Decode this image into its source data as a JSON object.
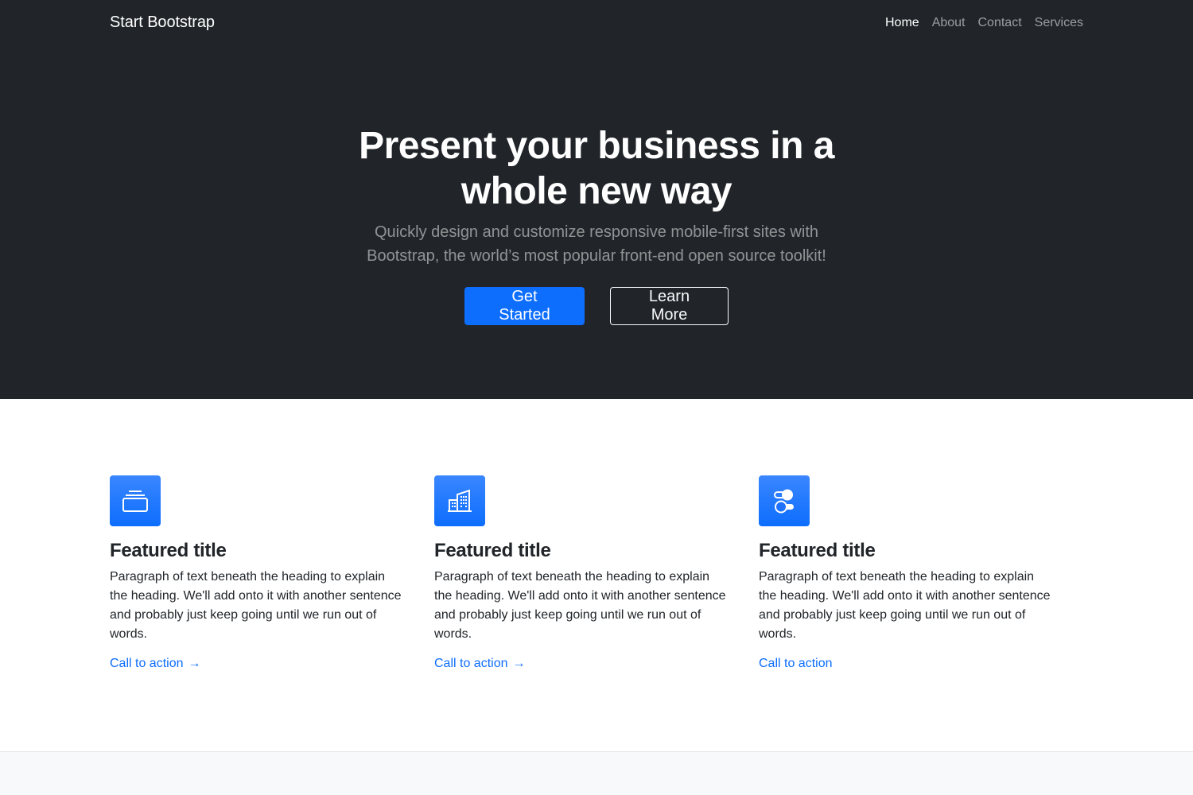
{
  "navbar": {
    "brand": "Start Bootstrap",
    "links": [
      {
        "label": "Home",
        "active": true
      },
      {
        "label": "About",
        "active": false
      },
      {
        "label": "Contact",
        "active": false
      },
      {
        "label": "Services",
        "active": false
      }
    ]
  },
  "hero": {
    "title": "Present your business in a whole new way",
    "subtitle": "Quickly design and customize responsive mobile-first sites with Bootstrap, the world’s most popular front-end open source toolkit!",
    "primary_button": "Get Started",
    "secondary_button": "Learn More"
  },
  "features": [
    {
      "icon": "collection-icon",
      "title": "Featured title",
      "text": "Paragraph of text beneath the heading to explain the heading. We'll add onto it with another sentence and probably just keep going until we run out of words.",
      "link": "Call to action",
      "arrow": "→"
    },
    {
      "icon": "building-icon",
      "title": "Featured title",
      "text": "Paragraph of text beneath the heading to explain the heading. We'll add onto it with another sentence and probably just keep going until we run out of words.",
      "link": "Call to action",
      "arrow": "→"
    },
    {
      "icon": "toggles-icon",
      "title": "Featured title",
      "text": "Paragraph of text beneath the heading to explain the heading. We'll add onto it with another sentence and probably just keep going until we run out of words.",
      "link": "Call to action",
      "arrow": ""
    }
  ],
  "colors": {
    "dark_bg": "#212529",
    "primary": "#0d6efd",
    "light_bg": "#f8f9fa"
  }
}
